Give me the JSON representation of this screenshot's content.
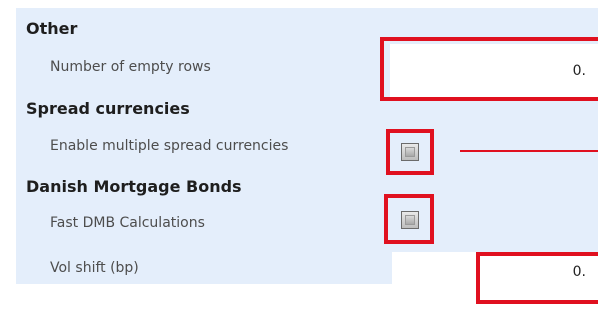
{
  "sections": {
    "other": {
      "title": "Other",
      "empty_rows_label": "Number of empty rows",
      "empty_rows_value": "0."
    },
    "spread": {
      "title": "Spread currencies",
      "multi_currency_label": "Enable multiple spread currencies",
      "multi_currency_checked": false
    },
    "dmb": {
      "title": "Danish Mortgage Bonds",
      "fast_calc_label": "Fast DMB Calculations",
      "fast_calc_checked": false,
      "vol_shift_label": "Vol shift (bp)",
      "vol_shift_value": "0."
    }
  },
  "colors": {
    "panel_bg": "#e4eefb",
    "highlight": "#e0101f"
  }
}
